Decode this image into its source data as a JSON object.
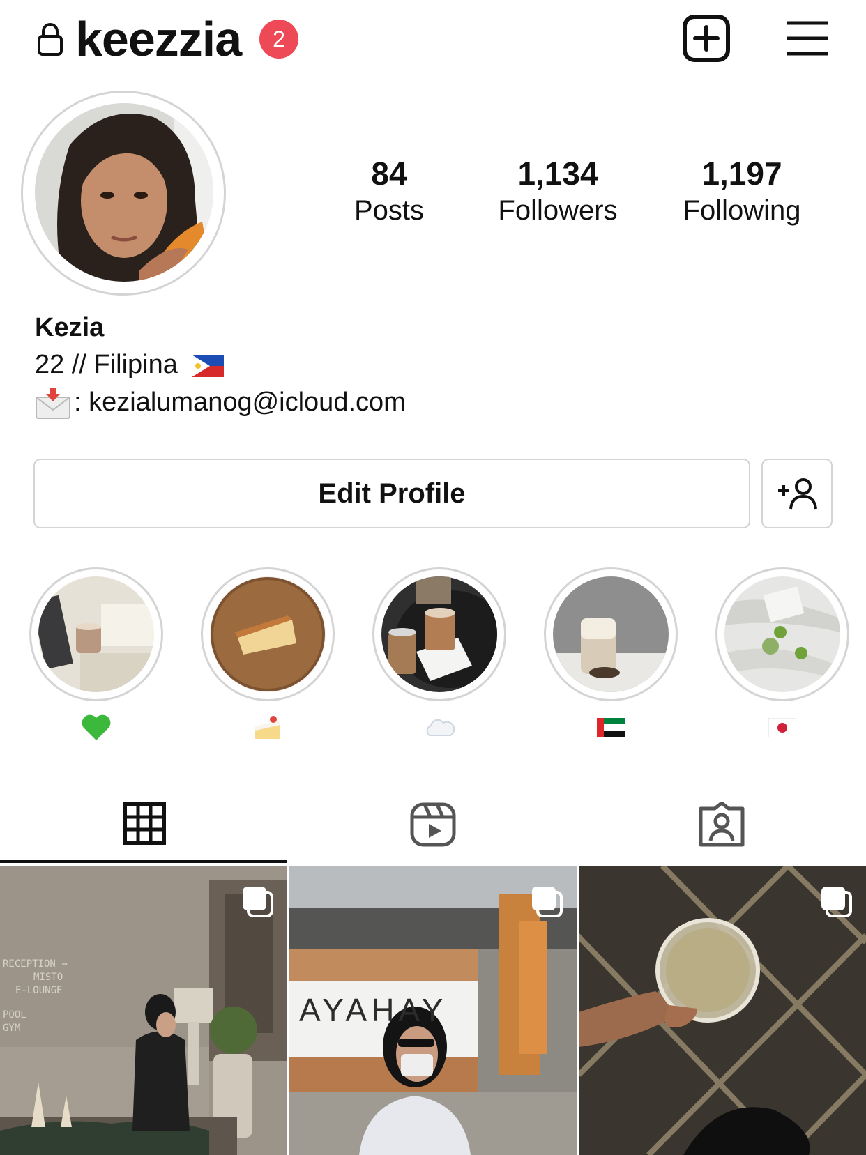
{
  "header": {
    "username": "keezzia",
    "notification_count": "2"
  },
  "profile": {
    "stats": [
      {
        "value": "84",
        "label": "Posts"
      },
      {
        "value": "1,134",
        "label": "Followers"
      },
      {
        "value": "1,197",
        "label": "Following"
      }
    ]
  },
  "bio": {
    "name": "Kezia",
    "line1": "22 // Filipina",
    "line2": ": kezialumanog@icloud.com"
  },
  "actions": {
    "edit_profile": "Edit Profile"
  },
  "highlights": [
    {
      "label_icon": "green-heart-icon"
    },
    {
      "label_icon": "cake-icon"
    },
    {
      "label_icon": "cloud-icon"
    },
    {
      "label_icon": "uae-flag-icon"
    },
    {
      "label_icon": "japan-flag-icon"
    }
  ],
  "tabs": [
    "grid-icon",
    "reels-icon",
    "tagged-icon"
  ],
  "posts": [
    {
      "signage": [
        "RECEPTION →",
        "MISTO",
        "E-LOUNGE",
        "POOL",
        "GYM"
      ]
    },
    {
      "signage": [
        "AYAHAY"
      ]
    },
    {
      "signage": []
    }
  ],
  "colors": {
    "badge": "#ed4956",
    "border": "#d4d4d4",
    "text": "#111111"
  }
}
